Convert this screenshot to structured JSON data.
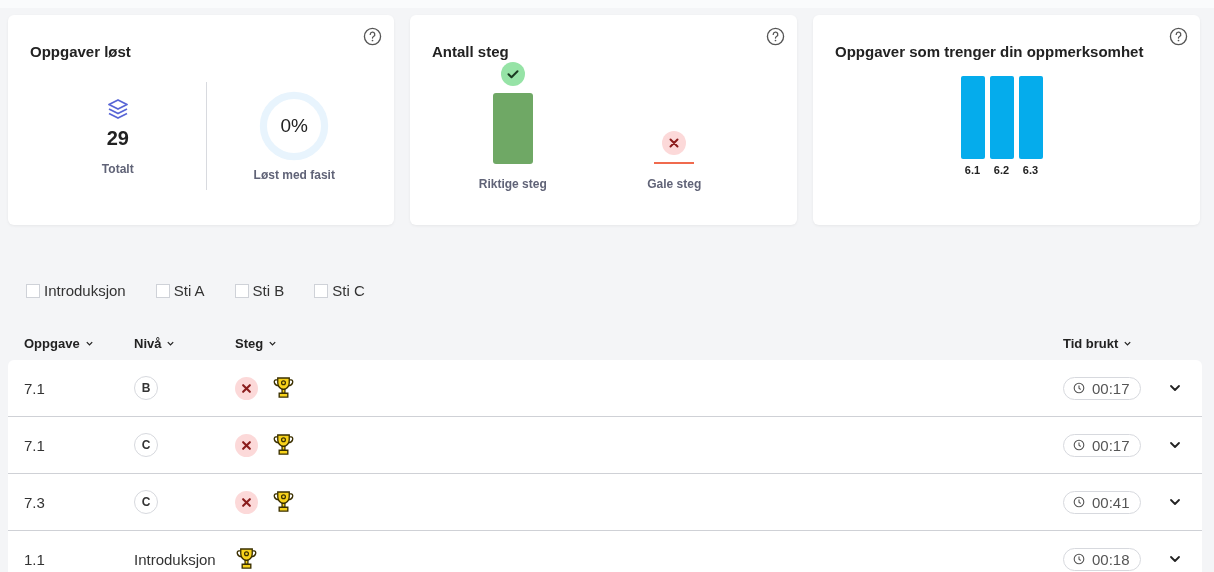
{
  "cards": {
    "solved": {
      "title": "Oppgaver løst",
      "total": "29",
      "total_label": "Totalt",
      "ring": {
        "value": "0%",
        "label": "Løst med fasit"
      }
    },
    "steps": {
      "title": "Antall steg",
      "bars": [
        {
          "kind": "correct",
          "label": "Riktige steg"
        },
        {
          "kind": "wrong",
          "label": "Gale steg"
        }
      ]
    },
    "attention": {
      "title": "Oppgaver som trenger din oppmerksomhet",
      "bars": [
        {
          "label": "6.1"
        },
        {
          "label": "6.2"
        },
        {
          "label": "6.3"
        }
      ]
    }
  },
  "filters": [
    {
      "label": "Introduksjon",
      "checked": false
    },
    {
      "label": "Sti A",
      "checked": false
    },
    {
      "label": "Sti B",
      "checked": false
    },
    {
      "label": "Sti C",
      "checked": false
    }
  ],
  "table": {
    "columns": [
      "Oppgave",
      "Nivå",
      "Steg",
      "Tid brukt"
    ],
    "rows": [
      {
        "task": "7.1",
        "level": {
          "kind": "badge",
          "text": "B"
        },
        "steps": [
          {
            "kind": "wrong"
          },
          {
            "kind": "trophy"
          }
        ],
        "time": "00:17",
        "expanded": false
      },
      {
        "task": "7.1",
        "level": {
          "kind": "badge",
          "text": "C"
        },
        "steps": [
          {
            "kind": "wrong"
          },
          {
            "kind": "trophy"
          }
        ],
        "time": "00:17",
        "expanded": false
      },
      {
        "task": "7.3",
        "level": {
          "kind": "badge",
          "text": "C"
        },
        "steps": [
          {
            "kind": "wrong"
          },
          {
            "kind": "trophy"
          }
        ],
        "time": "00:41",
        "expanded": false
      },
      {
        "task": "1.1",
        "level": {
          "kind": "text",
          "text": "Introduksjon"
        },
        "steps": [
          {
            "kind": "trophy"
          }
        ],
        "time": "00:18",
        "expanded": false
      }
    ]
  }
}
